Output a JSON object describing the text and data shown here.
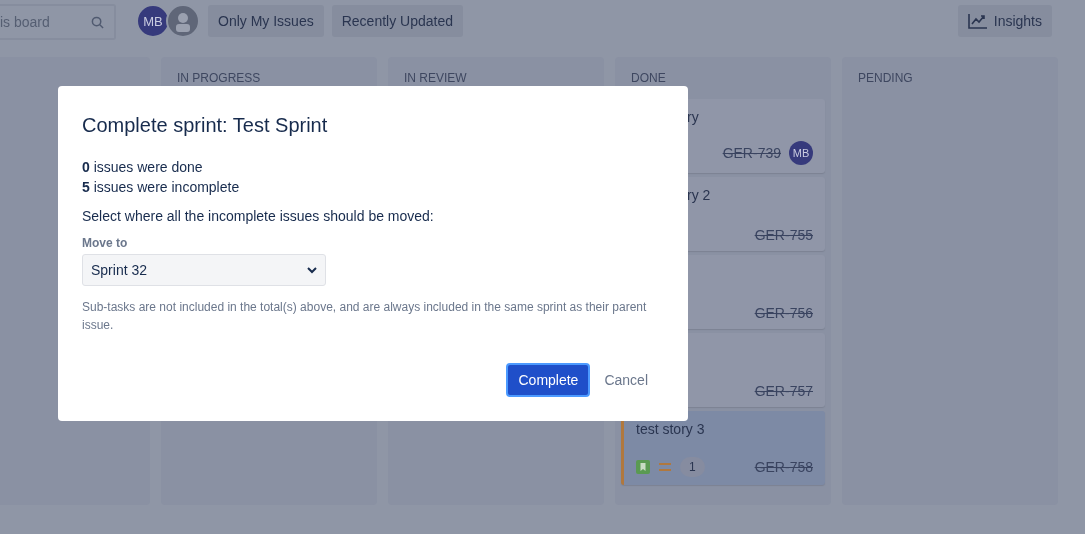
{
  "toolbar": {
    "search": {
      "value": "is board"
    },
    "avatars": [
      {
        "initials": "MB",
        "kind": "initials"
      },
      {
        "kind": "silhouette"
      }
    ],
    "filters": [
      "Only My Issues",
      "Recently Updated"
    ],
    "insights": "Insights"
  },
  "columns": [
    {},
    {
      "title": "IN PROGRESS"
    },
    {
      "title": "IN REVIEW"
    },
    {
      "title": "DONE",
      "cards": [
        {
          "title": "ry",
          "key": "GER-739",
          "assignee": "MB",
          "selected": false,
          "covered": true
        },
        {
          "title": "ry 2",
          "key": "GER-755",
          "selected": false,
          "covered": true
        },
        {
          "key": "GER-756",
          "selected": false
        },
        {
          "key": "GER-757",
          "selected": false
        },
        {
          "title": "test story 3",
          "key": "GER-758",
          "count": "1",
          "selected": true,
          "covered": false
        }
      ]
    },
    {
      "title": "PENDING"
    }
  ],
  "dialog": {
    "title": "Complete sprint: Test Sprint",
    "stats": [
      "**0** issues were done",
      "**5** issues were incomplete"
    ],
    "prompt": "Select where all the incomplete issues should be moved:",
    "field_label": "Move to",
    "select_value": "Sprint 32",
    "note": "Sub-tasks are not included in the total(s) above, and are always included in the same sprint as their parent issue.",
    "primary": "Complete",
    "secondary": "Cancel"
  }
}
